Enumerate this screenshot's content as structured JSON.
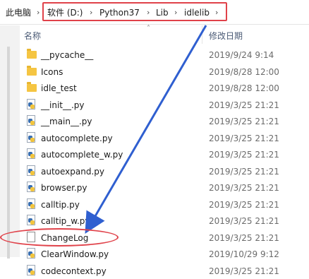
{
  "breadcrumb": {
    "items": [
      {
        "label": "此电脑"
      },
      {
        "label": "软件 (D:)"
      },
      {
        "label": "Python37"
      },
      {
        "label": "Lib"
      },
      {
        "label": "idlelib"
      }
    ],
    "separator_icon": "chevron-right-icon"
  },
  "columns": {
    "name": "名称",
    "date": "修改日期"
  },
  "files": [
    {
      "name": "__pycache__",
      "date": "2019/9/24 9:14",
      "type": "folder"
    },
    {
      "name": "Icons",
      "date": "2019/8/28 12:00",
      "type": "folder"
    },
    {
      "name": "idle_test",
      "date": "2019/8/28 12:00",
      "type": "folder"
    },
    {
      "name": "__init__.py",
      "date": "2019/3/25 21:21",
      "type": "python"
    },
    {
      "name": "__main__.py",
      "date": "2019/3/25 21:21",
      "type": "python"
    },
    {
      "name": "autocomplete.py",
      "date": "2019/3/25 21:21",
      "type": "python"
    },
    {
      "name": "autocomplete_w.py",
      "date": "2019/3/25 21:21",
      "type": "python"
    },
    {
      "name": "autoexpand.py",
      "date": "2019/3/25 21:21",
      "type": "python"
    },
    {
      "name": "browser.py",
      "date": "2019/3/25 21:21",
      "type": "python"
    },
    {
      "name": "calltip.py",
      "date": "2019/3/25 21:21",
      "type": "python"
    },
    {
      "name": "calltip_w.py",
      "date": "2019/3/25 21:21",
      "type": "python"
    },
    {
      "name": "ChangeLog",
      "date": "2019/3/25 21:21",
      "type": "file"
    },
    {
      "name": "ClearWindow.py",
      "date": "2019/10/29 9:12",
      "type": "python"
    },
    {
      "name": "codecontext.py",
      "date": "2019/3/25 21:21",
      "type": "python"
    }
  ],
  "colors": {
    "highlight": "#e0424a",
    "arrow": "#2f5fd0"
  }
}
